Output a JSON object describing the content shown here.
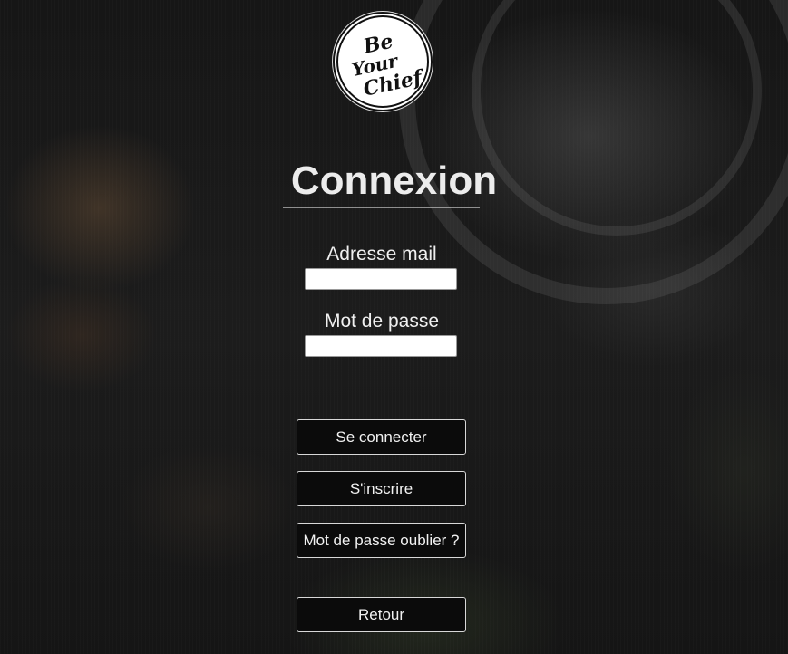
{
  "logo": {
    "alt": "Be Your Chief",
    "line1": "Be",
    "line2": "Your",
    "line3": "Chief"
  },
  "title": "Connexion",
  "form": {
    "email_label": "Adresse mail",
    "email_value": "",
    "password_label": "Mot de passe",
    "password_value": ""
  },
  "buttons": {
    "login": "Se connecter",
    "register": "S'inscrire",
    "forgot_password": "Mot de passe oublier ?",
    "back": "Retour"
  },
  "colors": {
    "background": "#1a1a1a",
    "text": "#ececec",
    "button_bg": "#0b0b0b",
    "button_border": "#d8d8d8"
  }
}
